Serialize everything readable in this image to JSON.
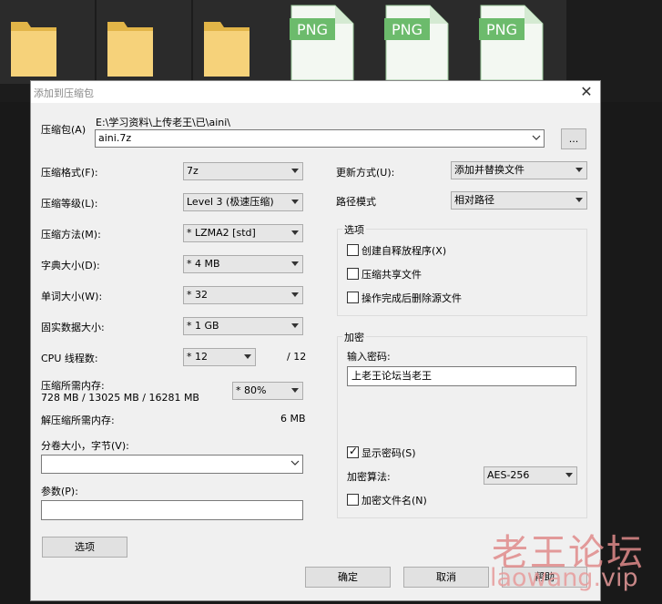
{
  "files": [
    {
      "type": "folder"
    },
    {
      "type": "folder"
    },
    {
      "type": "folder"
    },
    {
      "type": "png",
      "badge": "PNG"
    },
    {
      "type": "png",
      "badge": "PNG"
    },
    {
      "type": "png",
      "badge": "PNG"
    }
  ],
  "dialog": {
    "title": "添加到压缩包",
    "archive_label": "压缩包(A)",
    "archive_path": "E:\\学习资料\\上传老王\\已\\aini\\",
    "archive_name": "aini.7z",
    "browse_label": "...",
    "left": {
      "format_label": "压缩格式(F):",
      "format_value": "7z",
      "level_label": "压缩等级(L):",
      "level_value": "Level 3 (极速压缩)",
      "method_label": "压缩方法(M):",
      "method_value": "*  LZMA2 [std]",
      "dict_label": "字典大小(D):",
      "dict_value": "*  4 MB",
      "word_label": "单词大小(W):",
      "word_value": "*  32",
      "solid_label": "固实数据大小:",
      "solid_value": "*  1 GB",
      "cpu_label": "CPU 线程数:",
      "cpu_value": "*  12",
      "cpu_total": "/ 12",
      "mem_label": "压缩所需内存:",
      "mem_value": "728 MB / 13025 MB / 16281 MB",
      "mem_pct": "* 80%",
      "decomp_label": "解压缩所需内存:",
      "decomp_value": "6 MB",
      "split_label": "分卷大小，字节(V):",
      "split_value": "",
      "params_label": "参数(P):",
      "params_value": "",
      "options_button": "选项"
    },
    "right": {
      "update_label": "更新方式(U):",
      "update_value": "添加并替换文件",
      "path_label": "路径模式",
      "path_value": "相对路径",
      "options_group": "选项",
      "sfx_label": "创建自释放程序(X)",
      "shared_label": "压缩共享文件",
      "delete_label": "操作完成后删除源文件",
      "encrypt_group": "加密",
      "password_label": "输入密码:",
      "password_value": "上老王论坛当老王",
      "show_pwd_label": "显示密码(S)",
      "algo_label": "加密算法:",
      "algo_value": "AES-256",
      "encrypt_names_label": "加密文件名(N)"
    },
    "buttons": {
      "ok": "确定",
      "cancel": "取消",
      "help": "帮助"
    }
  },
  "watermark": {
    "line1": "老王论坛",
    "line2": "laowang.vip"
  },
  "colors": {
    "folder": "#f4c95d",
    "png_badge": "#6cbb6c",
    "dialog_bg": "#f0f0f0"
  }
}
